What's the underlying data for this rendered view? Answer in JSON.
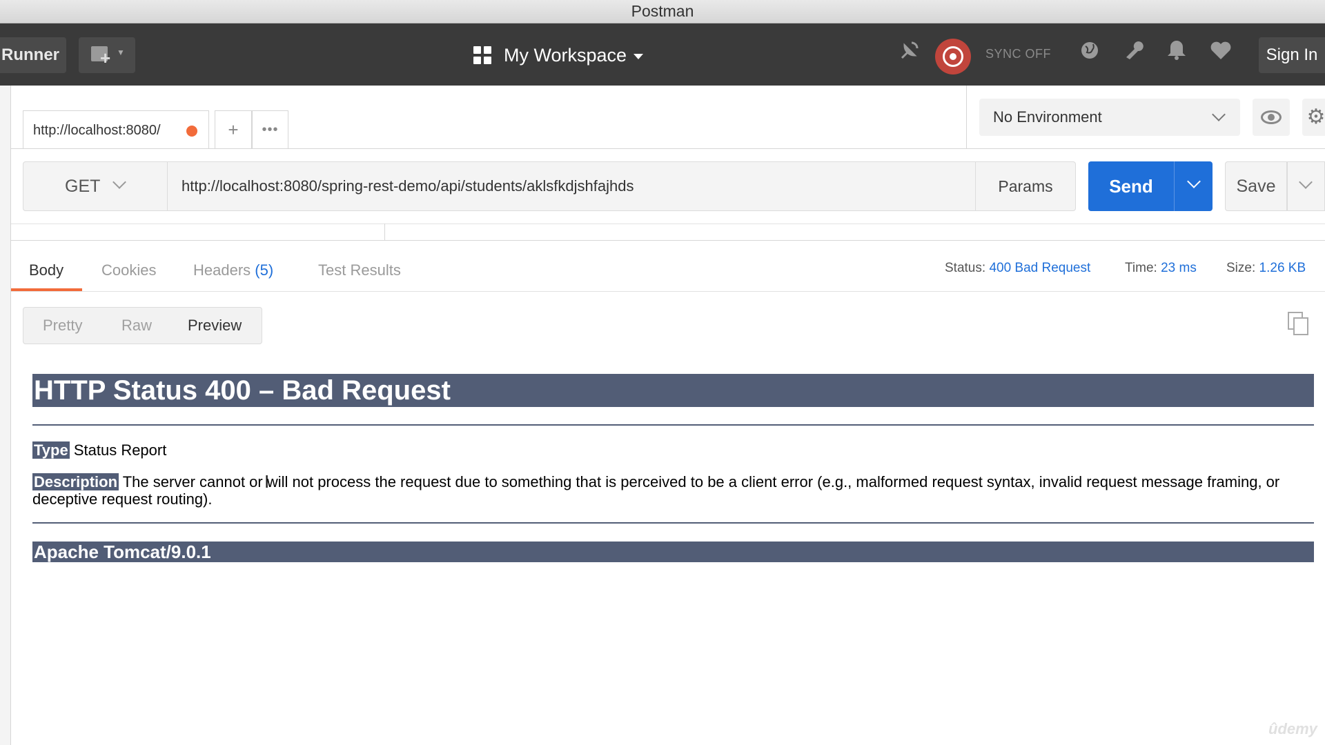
{
  "window": {
    "title": "Postman"
  },
  "header": {
    "runner_label": "Runner",
    "workspace_label": "My Workspace",
    "sync_label": "SYNC OFF",
    "signin_label": "Sign In",
    "icons": [
      "new-icon",
      "satellite-icon",
      "sync-icon",
      "globe-icon",
      "wrench-icon",
      "bell-icon",
      "heart-icon"
    ]
  },
  "tabs": {
    "active_tab_label": "http://localhost:8080/",
    "add_label": "+",
    "more_label": "•••"
  },
  "environment": {
    "selected": "No Environment"
  },
  "request": {
    "method": "GET",
    "url": "http://localhost:8080/spring-rest-demo/api/students/aklsfkdjshfajhds",
    "params_label": "Params",
    "send_label": "Send",
    "save_label": "Save"
  },
  "response": {
    "tabs": [
      {
        "label": "Body"
      },
      {
        "label": "Cookies"
      },
      {
        "label": "Headers",
        "count": "(5)"
      },
      {
        "label": "Test Results"
      }
    ],
    "status_label": "Status:",
    "status_value": "400 Bad Request",
    "time_label": "Time:",
    "time_value": "23 ms",
    "size_label": "Size:",
    "size_value": "1.26 KB",
    "view_modes": [
      "Pretty",
      "Raw",
      "Preview"
    ],
    "active_view": "Preview"
  },
  "preview": {
    "heading": "HTTP Status 400 – Bad Request",
    "type_label": "Type",
    "type_value": " Status Report",
    "description_label": "Description",
    "description_value": " The server cannot or will not process the request due to something that is perceived to be a client error (e.g., malformed request syntax, invalid request message framing, or deceptive request routing).",
    "footer": "Apache Tomcat/9.0.1"
  },
  "watermark": "ûdemy",
  "colors": {
    "accent_blue": "#1f6fd9",
    "tab_orange": "#f26b3a",
    "sync_red": "#c1453c",
    "tomcat_header": "#525d76",
    "header_bg": "#3a3a3a"
  }
}
